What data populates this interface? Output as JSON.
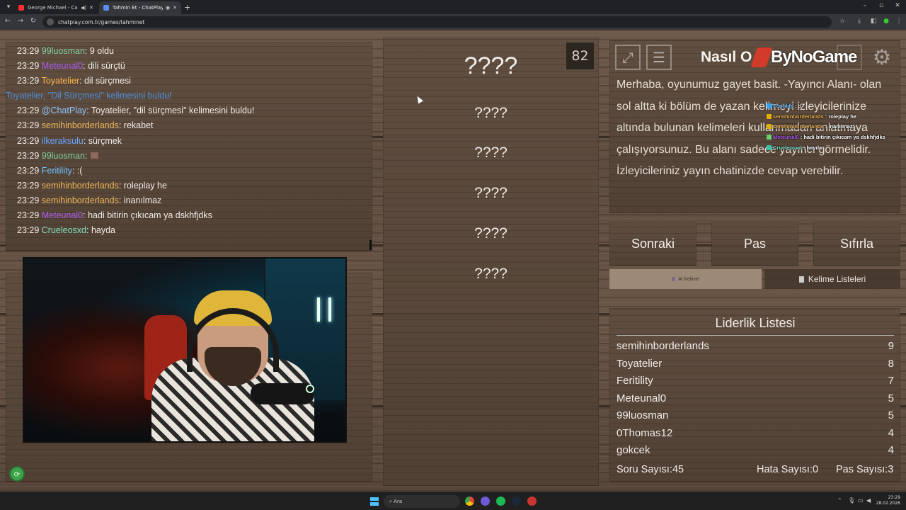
{
  "browser": {
    "tabs": [
      {
        "title": "George Michael - Careless",
        "favicon_color": "#ff2d2d"
      },
      {
        "title": "Tahmin Et - ChatPlay",
        "favicon_color": "#5b8def"
      }
    ],
    "url": "chatplay.com.tr/games/tahminet"
  },
  "chat": {
    "lines": [
      {
        "time": "23:29",
        "user": "99luosman",
        "user_color": "#7fd0a0",
        "text": ": 9 oldu"
      },
      {
        "time": "23:29",
        "user": "Meteunal0",
        "user_color": "#b05cf0",
        "text": ": dili sürçtü"
      },
      {
        "time": "23:29",
        "user": "Toyatelier",
        "user_color": "#ffb64a",
        "text": ": dil sürçmesi"
      },
      {
        "system": true,
        "text": "Toyatelier, \"Dil Sürçmesi\" kelimesini buldu!"
      },
      {
        "time": "23:29",
        "user": "@ChatPlay",
        "user_color": "#8fc7ff",
        "text": ": Toyatelier, \"dil sürçmesi\" kelimesini buldu!"
      },
      {
        "time": "23:29",
        "user": "semihinborderlands",
        "user_color": "#f0b85a",
        "text": ": rekabet"
      },
      {
        "time": "23:29",
        "user": "ilkeraksulu",
        "user_color": "#6aa5ff",
        "text": ": sürçmek"
      },
      {
        "time": "23:29",
        "user": "99luosman",
        "user_color": "#7fd0a0",
        "text": ":",
        "emote": true
      },
      {
        "time": "23:29",
        "user": "Feritility",
        "user_color": "#6ec1ff",
        "text": ": :("
      },
      {
        "time": "23:29",
        "user": "semihinborderlands",
        "user_color": "#f0b85a",
        "text": ": roleplay he"
      },
      {
        "time": "23:29",
        "user": "semihinborderlands",
        "user_color": "#f0b85a",
        "text": ": inanılmaz"
      },
      {
        "time": "23:29",
        "user": "Meteunal0",
        "user_color": "#b05cf0",
        "text": ": hadi bitirin çıkıcam ya dskhfjdks"
      },
      {
        "time": "23:29",
        "user": "Crueleosxd",
        "user_color": "#7fe0c0",
        "text": ": hayda"
      }
    ]
  },
  "game": {
    "counter": "82",
    "words": [
      "????",
      "????",
      "????",
      "????",
      "????",
      "????"
    ]
  },
  "info": {
    "title": "Nasıl O",
    "logo": "ByNoGame",
    "text": "Merhaba, oyunumuz gayet basit. -Yayıncı Alanı- olan sol altta ki bölüm de yazan kelimeyi izleyicilerinize altında bulunan kelimeleri kullanmadan anlatmaya çalışıyorsunuz. Bu alanı sadece yayıncı görmelidir. İzleyicileriniz yayın chatinizde cevap verebilir."
  },
  "overlay": {
    "lines": [
      {
        "user": "Feritility",
        "user_color": "#6ec1ff",
        "text": " : :(",
        "badge": "#2fa4ff"
      },
      {
        "user": "semihinborderlands",
        "user_color": "#f0b85a",
        "text": " : roleplay he",
        "badge": "#e0b000"
      },
      {
        "user": "semihinborderlands",
        "user_color": "#f0b85a",
        "text": " : inanılmaz",
        "badge": "#e0b000"
      },
      {
        "user": "Meteunal0",
        "user_color": "#b05cf0",
        "text": " : hadi bitirin çıkıcam ya dskhfjdks",
        "badge": "#6bd06b"
      },
      {
        "user": "Crueleosxd",
        "user_color": "#7fe0c0",
        "text": " : hayda",
        "badge": "#34c3a8"
      }
    ]
  },
  "buttons": {
    "next": "Sonraki",
    "pass": "Pas",
    "reset": "Sıfırla",
    "get_word": "Al Kelime",
    "word_lists": "Kelime Listeleri"
  },
  "leaderboard": {
    "title": "Liderlik Listesi",
    "rows": [
      {
        "name": "semihinborderlands",
        "score": "9"
      },
      {
        "name": "Toyatelier",
        "score": "8"
      },
      {
        "name": "Feritility",
        "score": "7"
      },
      {
        "name": "Meteunal0",
        "score": "5"
      },
      {
        "name": "99luosman",
        "score": "5"
      },
      {
        "name": "0Thomas12",
        "score": "4"
      },
      {
        "name": "gokcek",
        "score": "4"
      }
    ],
    "questions": "Soru Sayısı:45",
    "errors": "Hata Sayısı:0",
    "passes": "Pas Sayısı:3"
  },
  "taskbar": {
    "search_placeholder": "Ara",
    "time": "23:29",
    "date": "28.02.2026"
  }
}
